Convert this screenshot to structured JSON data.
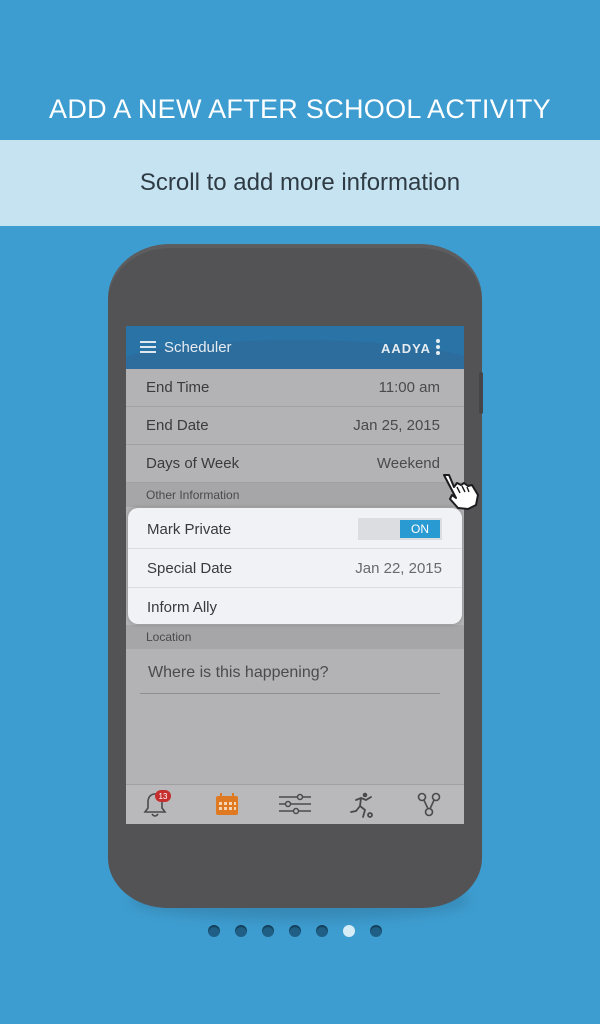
{
  "headline": "ADD A NEW AFTER SCHOOL ACTIVITY",
  "subtitle": "Scroll to add more information",
  "app": {
    "title": "Scheduler",
    "brand": "AADYA"
  },
  "rows": [
    {
      "label": "End Time",
      "value": "11:00 am"
    },
    {
      "label": "End Date",
      "value": "Jan 25, 2015"
    },
    {
      "label": "Days of Week",
      "value": "Weekend"
    }
  ],
  "sections": {
    "other_info": "Other Information",
    "location": "Location"
  },
  "card": {
    "mark_private_label": "Mark Private",
    "toggle_label": "ON",
    "special_date_label": "Special Date",
    "special_date_value": "Jan 22, 2015",
    "inform_ally_label": "Inform Ally"
  },
  "location_placeholder": "Where is this happening?",
  "bottom_nav": {
    "notifications_badge": "13",
    "items": [
      "bell-icon",
      "calendar-icon",
      "sliders-icon",
      "activity-icon",
      "share-icon"
    ]
  },
  "pager": {
    "total": 7,
    "active_index": 5
  },
  "colors": {
    "background": "#3e9dd0",
    "banner": "#c6e3f1",
    "phone": "#535355",
    "appbar": "#2a73a6",
    "toggle_on": "#2a9ad3",
    "badge": "#c62f2f",
    "calendar_icon": "#e07a22"
  }
}
